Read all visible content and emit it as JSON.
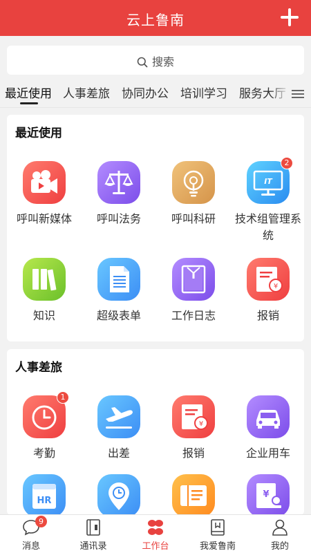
{
  "header": {
    "title": "云上鲁南",
    "add_icon": "plus-icon"
  },
  "search": {
    "placeholder": "搜索",
    "icon": "search-icon"
  },
  "tabs": [
    {
      "label": "最近使用",
      "active": true
    },
    {
      "label": "人事差旅",
      "active": false
    },
    {
      "label": "协同办公",
      "active": false
    },
    {
      "label": "培训学习",
      "active": false
    },
    {
      "label": "服务大厅",
      "active": false
    }
  ],
  "recent": {
    "title": "最近使用",
    "apps": [
      {
        "label": "呼叫新媒体",
        "icon": "video-camera-icon",
        "color": "#ef3f40"
      },
      {
        "label": "呼叫法务",
        "icon": "scales-icon",
        "color": "#7c4dea"
      },
      {
        "label": "呼叫科研",
        "icon": "lightbulb-icon",
        "color": "#d5944a"
      },
      {
        "label": "技术组管理系统",
        "icon": "it-monitor-icon",
        "color": "#2a8cf0",
        "badge": "2"
      },
      {
        "label": "知识",
        "icon": "books-icon",
        "color": "#6bc02a"
      },
      {
        "label": "超级表单",
        "icon": "form-document-icon",
        "color": "#3c8ef5"
      },
      {
        "label": "工作日志",
        "icon": "notebook-icon",
        "color": "#7c4dea"
      },
      {
        "label": "报销",
        "icon": "reimbursement-icon",
        "color": "#ef3f40"
      }
    ]
  },
  "travel": {
    "title": "人事差旅",
    "apps": [
      {
        "label": "考勤",
        "icon": "clock-icon",
        "color": "#ef3f40",
        "badge": "1"
      },
      {
        "label": "出差",
        "icon": "airplane-icon",
        "color": "#3c8ef5"
      },
      {
        "label": "报销",
        "icon": "reimbursement-icon",
        "color": "#ef3f40"
      },
      {
        "label": "企业用车",
        "icon": "car-icon",
        "color": "#7c4dea"
      },
      {
        "label": "",
        "icon": "hr-icon",
        "color": "#3c8ef5"
      },
      {
        "label": "",
        "icon": "location-clock-icon",
        "color": "#3c8ef5"
      },
      {
        "label": "",
        "icon": "ticket-icon",
        "color": "#ff8a1f"
      },
      {
        "label": "",
        "icon": "yuan-document-icon",
        "color": "#7c4dea"
      }
    ]
  },
  "bottom_nav": [
    {
      "label": "消息",
      "icon": "chat-bubble-icon",
      "badge": "9",
      "active": false
    },
    {
      "label": "通讯录",
      "icon": "address-book-icon",
      "active": false
    },
    {
      "label": "工作台",
      "icon": "workbench-icon",
      "active": true
    },
    {
      "label": "我爱鲁南",
      "icon": "bookmark-book-icon",
      "active": false
    },
    {
      "label": "我的",
      "icon": "person-icon",
      "active": false
    }
  ],
  "colors": {
    "brand": "#e8423f",
    "badge": "#ec4a3f"
  }
}
